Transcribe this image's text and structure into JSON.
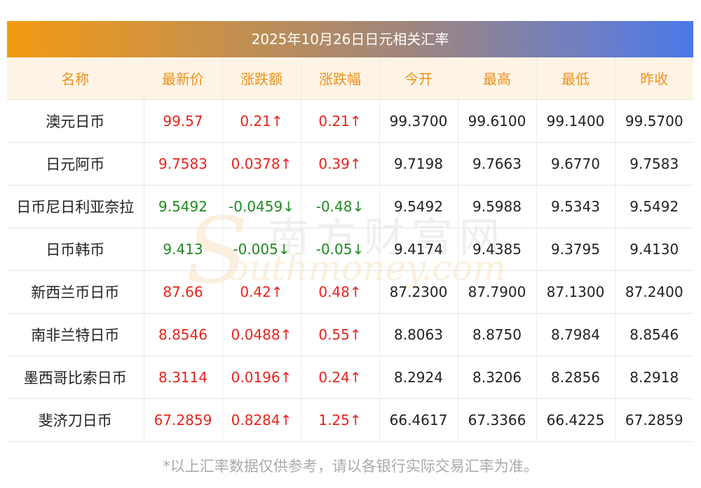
{
  "title": "2025年10月26日日元相关汇率",
  "headers": [
    "名称",
    "最新价",
    "涨跌额",
    "涨跌幅",
    "今开",
    "最高",
    "最低",
    "昨收"
  ],
  "rows": [
    {
      "name": "澳元日币",
      "latest": "99.57",
      "change": "0.21↑",
      "pct": "0.21↑",
      "open": "99.3700",
      "high": "99.6100",
      "low": "99.1400",
      "prev": "99.5700",
      "dir": "up"
    },
    {
      "name": "日元阿币",
      "latest": "9.7583",
      "change": "0.0378↑",
      "pct": "0.39↑",
      "open": "9.7198",
      "high": "9.7663",
      "low": "9.6770",
      "prev": "9.7583",
      "dir": "up"
    },
    {
      "name": "日币尼日利亚奈拉",
      "latest": "9.5492",
      "change": "-0.0459↓",
      "pct": "-0.48↓",
      "open": "9.5492",
      "high": "9.5988",
      "low": "9.5343",
      "prev": "9.5492",
      "dir": "down"
    },
    {
      "name": "日币韩币",
      "latest": "9.413",
      "change": "-0.005↓",
      "pct": "-0.05↓",
      "open": "9.4174",
      "high": "9.4385",
      "low": "9.3795",
      "prev": "9.4130",
      "dir": "down"
    },
    {
      "name": "新西兰币日币",
      "latest": "87.66",
      "change": "0.42↑",
      "pct": "0.48↑",
      "open": "87.2300",
      "high": "87.7900",
      "low": "87.1300",
      "prev": "87.2400",
      "dir": "up"
    },
    {
      "name": "南非兰特日币",
      "latest": "8.8546",
      "change": "0.0488↑",
      "pct": "0.55↑",
      "open": "8.8063",
      "high": "8.8750",
      "low": "8.7984",
      "prev": "8.8546",
      "dir": "up"
    },
    {
      "name": "墨西哥比索日币",
      "latest": "8.3114",
      "change": "0.0196↑",
      "pct": "0.24↑",
      "open": "8.2924",
      "high": "8.3206",
      "low": "8.2856",
      "prev": "8.2918",
      "dir": "up"
    },
    {
      "name": "斐济刀日币",
      "latest": "67.2859",
      "change": "0.8284↑",
      "pct": "1.25↑",
      "open": "66.4617",
      "high": "67.3366",
      "low": "66.4225",
      "prev": "67.2859",
      "dir": "up"
    }
  ],
  "watermark": {
    "cn": "南方财富网",
    "en": "outhmoney.com",
    "s": "S"
  },
  "footer": "*以上汇率数据仅供参考，请以各银行实际交易汇率为准。",
  "colors": {
    "up": "#e8231c",
    "down": "#1f8a1f",
    "header_text": "#f0901a",
    "header_bg": "#fdf4e6"
  }
}
